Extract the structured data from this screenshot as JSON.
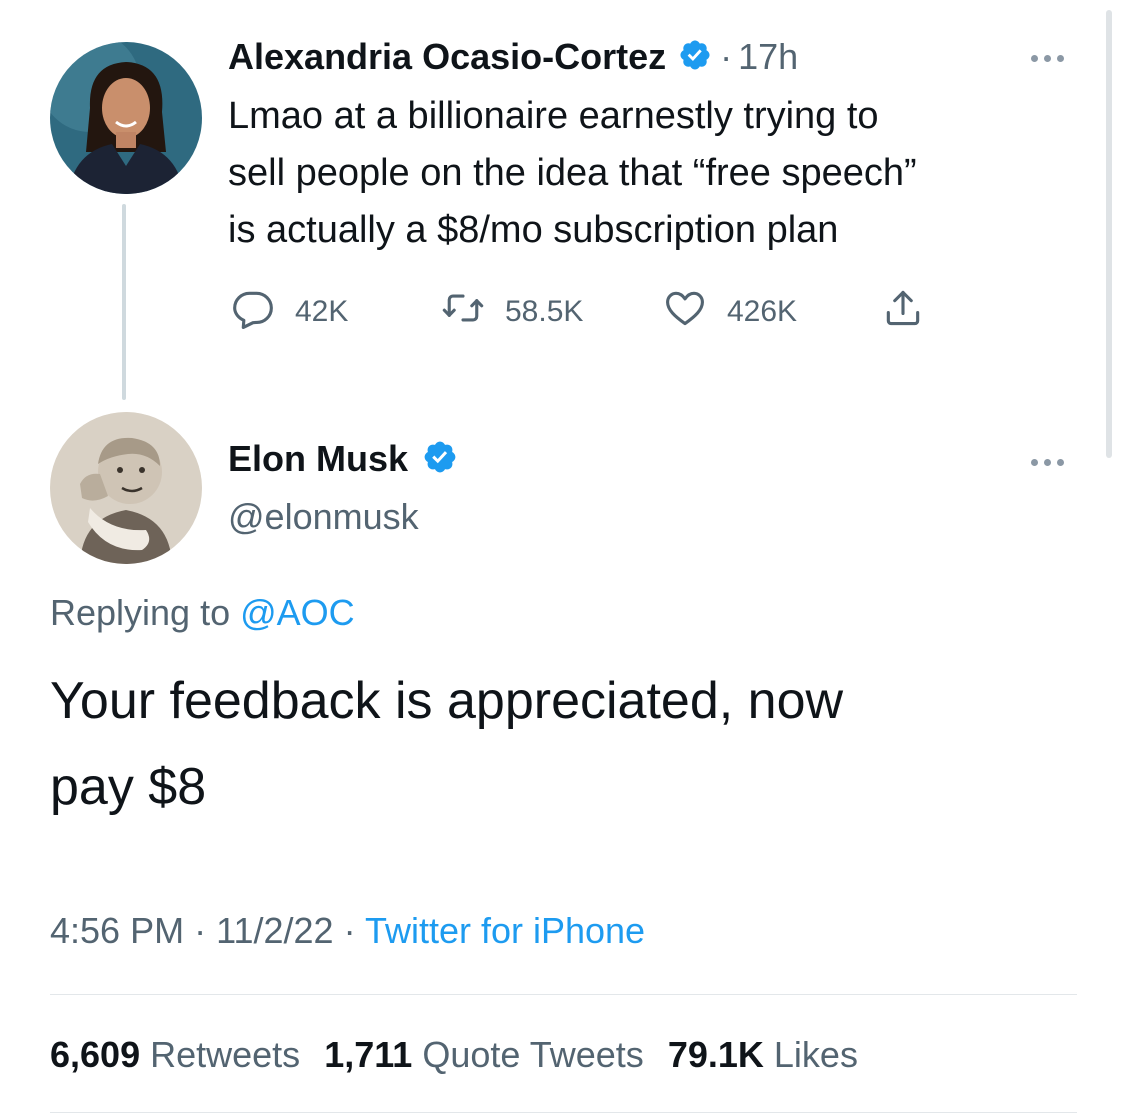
{
  "tweet1": {
    "author_name": "Alexandria Ocasio-Cortez",
    "separator": "·",
    "time_ago": "17h",
    "text_lines": [
      "Lmao at a billionaire earnestly trying to",
      "sell people on the idea that “free speech”",
      "is actually a $8/mo subscription plan"
    ],
    "actions": {
      "replies": "42K",
      "retweets": "58.5K",
      "likes": "426K"
    }
  },
  "tweet2": {
    "author_name": "Elon Musk",
    "handle": "@elonmusk",
    "replying_prefix": "Replying to",
    "replying_handle": "@AOC",
    "text_lines": [
      "Your feedback is appreciated, now",
      "pay $8"
    ],
    "time": "4:56 PM",
    "date": "11/2/22",
    "sep": "·",
    "source": "Twitter for iPhone",
    "stats": {
      "retweets_count": "6,609",
      "retweets_label": "Retweets",
      "quotes_count": "1,711",
      "quotes_label": "Quote Tweets",
      "likes_count": "79.1K",
      "likes_label": "Likes"
    }
  },
  "icons": {
    "verified": "verified-badge-icon",
    "reply": "reply-icon",
    "retweet": "retweet-icon",
    "like": "heart-icon",
    "share": "share-icon",
    "more": "more-icon"
  },
  "colors": {
    "accent": "#1d9bf0",
    "text": "#0f1419",
    "secondary": "#536471",
    "thread_line": "#cfd9de"
  }
}
